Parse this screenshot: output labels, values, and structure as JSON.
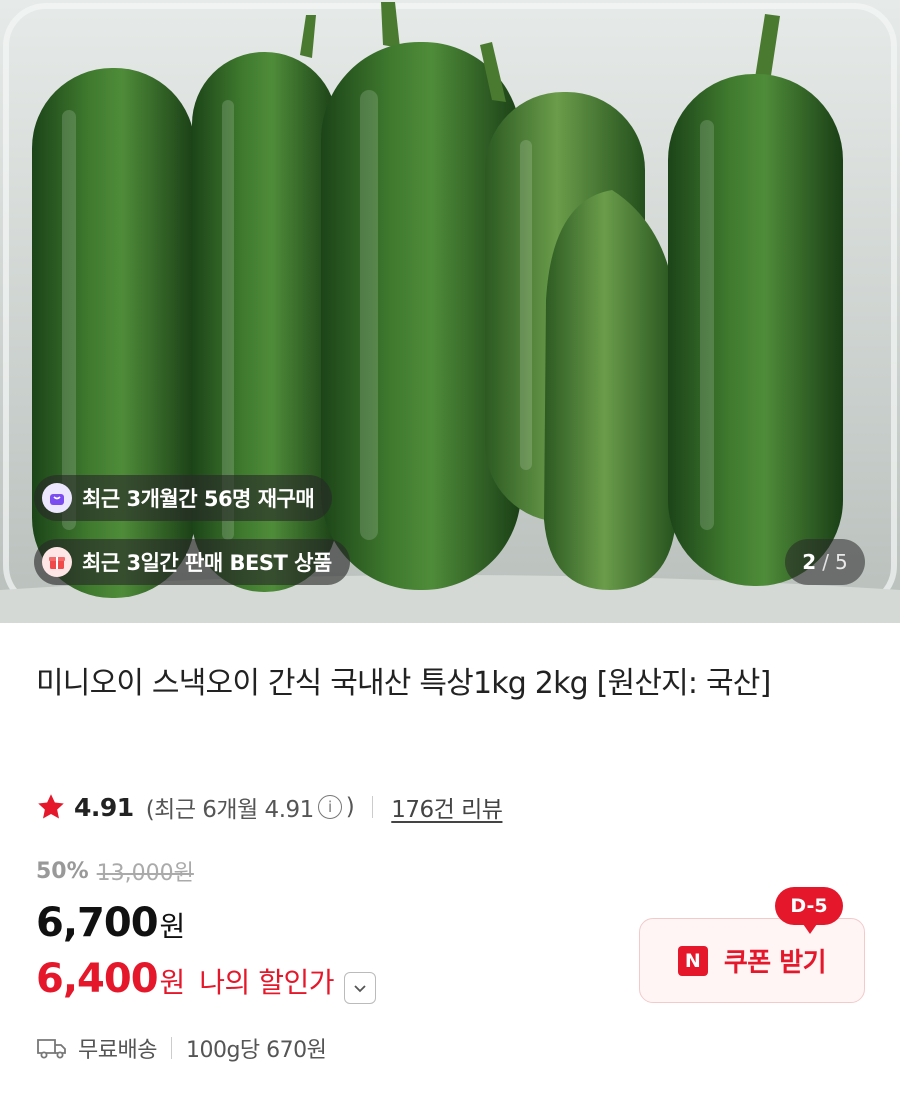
{
  "gallery": {
    "badges": {
      "repurchase": "최근 3개월간 56명 재구매",
      "best": "최근 3일간 판매 BEST 상품"
    },
    "pager": {
      "current": "2",
      "separator": "/",
      "total": "5"
    }
  },
  "product": {
    "title": "미니오이 스낵오이 간식 국내산 특상1kg 2kg [원산지: 국산]",
    "rating": {
      "score": "4.91",
      "recent": "(최근 6개월 4.91",
      "recent_close": ")",
      "info_glyph": "i",
      "reviews": "176건 리뷰"
    },
    "price": {
      "discount_rate": "50%",
      "original": "13,000원",
      "sale": "6,700",
      "currency": "원",
      "my_price": "6,400",
      "my_currency": "원",
      "my_price_label": "나의 할인가"
    },
    "coupon": {
      "dday": "D-5",
      "brand_glyph": "N",
      "label": "쿠폰 받기"
    },
    "shipping": {
      "delivery": "무료배송",
      "unit_price": "100g당 670원"
    }
  },
  "colors": {
    "accent": "#e5182b",
    "text": "#222222",
    "muted": "#999999"
  }
}
